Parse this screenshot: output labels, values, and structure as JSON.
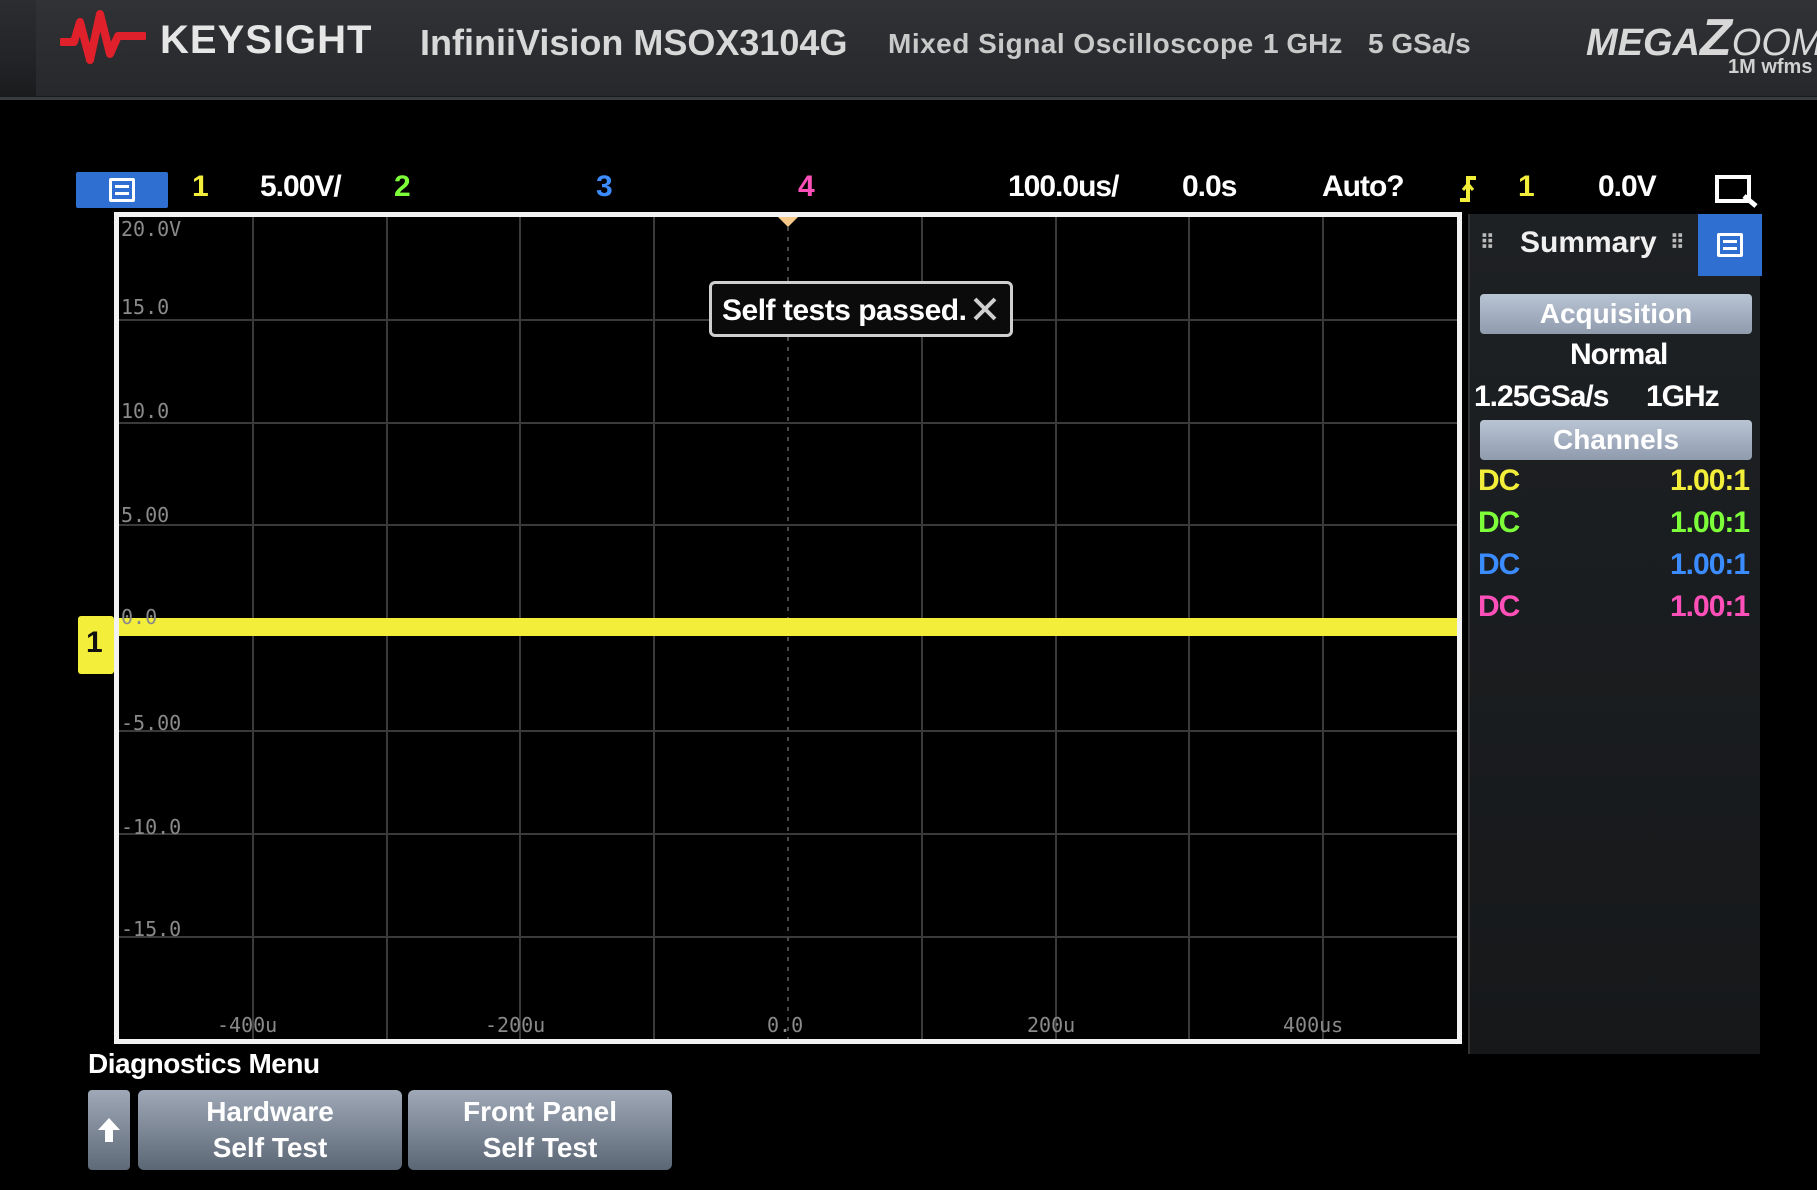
{
  "header": {
    "brand": "KEYSIGHT",
    "model": "InfiniiVision MSOX3104G",
    "description": "Mixed Signal Oscilloscope",
    "bandwidth": "1 GHz",
    "sample_rate": "5 GSa/s",
    "megazoom": "MEGA",
    "megazoom_zoom": "OOM",
    "megazoom_sub": "1M wfms"
  },
  "status_bar": {
    "ch1_label": "1",
    "ch1_scale": "5.00V/",
    "ch2_label": "2",
    "ch3_label": "3",
    "ch4_label": "4",
    "time_scale": "100.0us/",
    "delay": "0.0s",
    "trigger_mode": "Auto?",
    "trigger_source": "1",
    "trigger_level": "0.0V"
  },
  "graticule": {
    "y_labels": [
      "20.0V",
      "15.0",
      "10.0",
      "5.00",
      "0.0",
      "-5.00",
      "-10.0",
      "-15.0"
    ],
    "x_labels": [
      "-400u",
      "-200u",
      "0.0",
      "200u",
      "400us"
    ],
    "ground_marker": "1"
  },
  "toast": {
    "message": "Self tests passed."
  },
  "summary_panel": {
    "title": "Summary",
    "acquisition_label": "Acquisition",
    "acq_mode": "Normal",
    "acq_rate": "1.25GSa/s",
    "acq_bw": "1GHz",
    "channels_label": "Channels",
    "channels": [
      {
        "coupling": "DC",
        "probe": "1.00:1",
        "color": "#f2ee3a"
      },
      {
        "coupling": "DC",
        "probe": "1.00:1",
        "color": "#7dff3a"
      },
      {
        "coupling": "DC",
        "probe": "1.00:1",
        "color": "#3b8cff"
      },
      {
        "coupling": "DC",
        "probe": "1.00:1",
        "color": "#ff4fb8"
      }
    ]
  },
  "softkeys": {
    "menu_title": "Diagnostics Menu",
    "hw_line1": "Hardware",
    "hw_line2": "Self Test",
    "fp_line1": "Front Panel",
    "fp_line2": "Self Test"
  },
  "colors": {
    "ch1": "#f2ee3a",
    "ch2": "#7dff3a",
    "ch3": "#3b8cff",
    "ch4": "#ff4fb8",
    "accent": "#2f6fd1"
  },
  "icons": [
    "keysight-logo-icon",
    "menu-icon",
    "close-icon",
    "trigger-edge-icon",
    "zoom-icon",
    "up-arrow-icon"
  ]
}
